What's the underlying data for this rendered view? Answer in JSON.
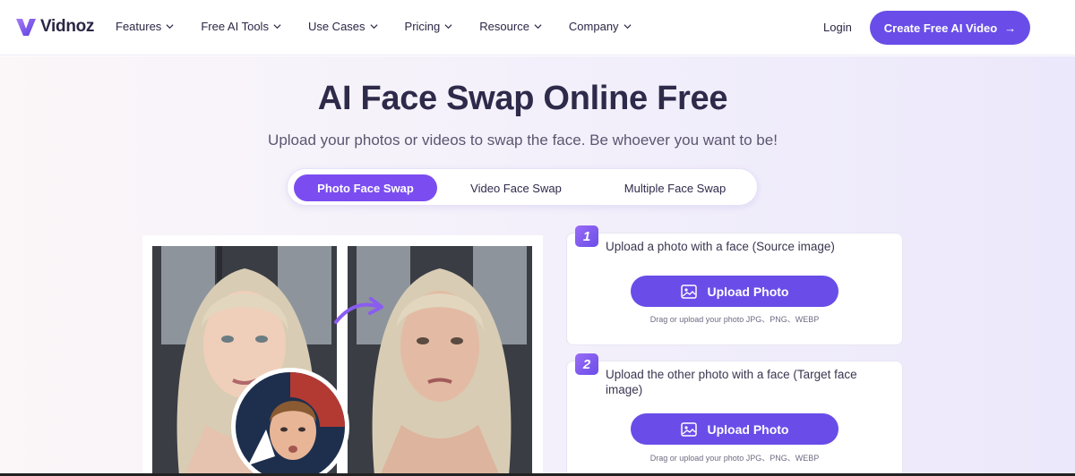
{
  "brand": {
    "name": "Vidnoz"
  },
  "nav": {
    "items": [
      {
        "label": "Features"
      },
      {
        "label": "Free AI Tools"
      },
      {
        "label": "Use Cases"
      },
      {
        "label": "Pricing"
      },
      {
        "label": "Resource"
      },
      {
        "label": "Company"
      }
    ],
    "login": "Login",
    "cta": "Create Free AI Video",
    "cta_arrow": "→"
  },
  "hero": {
    "title": "AI Face Swap Online Free",
    "subtitle": "Upload your photos or videos to swap the face. Be whoever you want to be!"
  },
  "tabs": [
    {
      "label": "Photo Face Swap",
      "active": true
    },
    {
      "label": "Video Face Swap",
      "active": false
    },
    {
      "label": "Multiple Face Swap",
      "active": false
    }
  ],
  "steps": [
    {
      "number": "1",
      "text": "Upload a photo with a face (Source image)",
      "button": "Upload Photo",
      "hint": "Drag or upload your photo JPG、PNG、WEBP"
    },
    {
      "number": "2",
      "text": "Upload the other photo with a face (Target face image)",
      "button": "Upload Photo",
      "hint": "Drag or upload your photo JPG、PNG、WEBP"
    }
  ],
  "colors": {
    "accent": "#6a4de8",
    "tab_active": "#7b4df0",
    "title": "#2e2a4a"
  },
  "icons": {
    "logo": "vidnoz-logo-icon",
    "chevron": "chevron-down-icon",
    "upload": "image-upload-icon",
    "swap_arrow": "curved-arrow-icon"
  }
}
